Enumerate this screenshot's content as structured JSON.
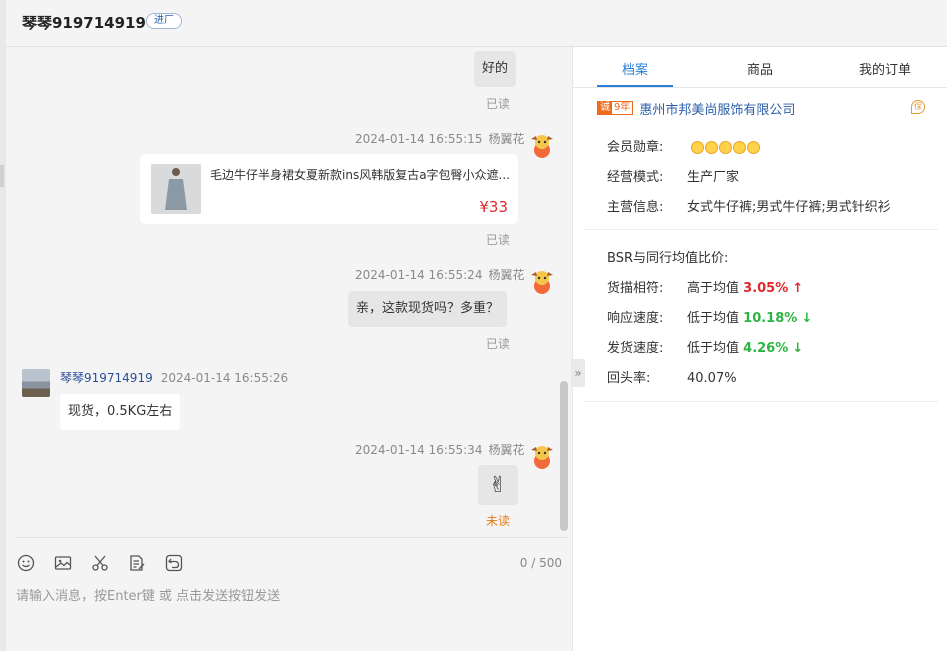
{
  "header": {
    "contact_name": "琴琴919714919",
    "badge": "进厂"
  },
  "messages": {
    "m1": {
      "text": "好的",
      "status": "已读"
    },
    "m2": {
      "time": "2024-01-14 16:55:15",
      "sender": "杨翼花",
      "product": {
        "title": "毛边牛仔半身裙女夏新款ins风韩版复古a字包臀小众遮...",
        "price": "¥33"
      },
      "status": "已读"
    },
    "m3": {
      "time": "2024-01-14 16:55:24",
      "sender": "杨翼花",
      "text": "亲，这款现货吗？多重？",
      "status": "已读"
    },
    "m4": {
      "sender": "琴琴919714919",
      "time": "2024-01-14 16:55:26",
      "text": "现货，0.5KG左右"
    },
    "m5": {
      "time": "2024-01-14 16:55:34",
      "sender": "杨翼花",
      "emoji": "✌",
      "status": "未读"
    }
  },
  "composer": {
    "counter": "0 / 500",
    "placeholder": "请输入消息，按Enter键 或 点击发送按钮发送",
    "tools": [
      "smile-icon",
      "image-icon",
      "scissors-icon",
      "document-edit-icon",
      "history-icon"
    ]
  },
  "right_panel": {
    "tabs": [
      {
        "label": "档案",
        "active": true
      },
      {
        "label": "商品",
        "active": false
      },
      {
        "label": "我的订单",
        "active": false
      }
    ],
    "company": {
      "years_icon": "诚",
      "years": "9年",
      "name": "惠州市邦美尚服饰有限公司",
      "corner_badge": "保"
    },
    "profile": [
      {
        "label": "会员勋章:",
        "value": "",
        "medals": 5
      },
      {
        "label": "经营模式:",
        "value": "生产厂家"
      },
      {
        "label": "主营信息:",
        "value": "女式牛仔裤;男式牛仔裤;男式针织衫"
      }
    ],
    "bsr": {
      "title": "BSR与同行均值比价:",
      "rows": [
        {
          "label": "货描相符:",
          "compare": "高于均值",
          "value": "3.05%",
          "arrow": "↑",
          "color": "#e0282e"
        },
        {
          "label": "响应速度:",
          "compare": "低于均值",
          "value": "10.18%",
          "arrow": "↓",
          "color": "#2db543"
        },
        {
          "label": "发货速度:",
          "compare": "低于均值",
          "value": "4.26%",
          "arrow": "↓",
          "color": "#2db543"
        },
        {
          "label": "回头率:",
          "compare": "40.07%",
          "value": "",
          "arrow": ""
        }
      ]
    }
  },
  "colors": {
    "accent": "#2a7fd6",
    "unread": "#e37c1a",
    "price": "#e0282e",
    "up": "#e0282e",
    "down": "#2db543"
  }
}
